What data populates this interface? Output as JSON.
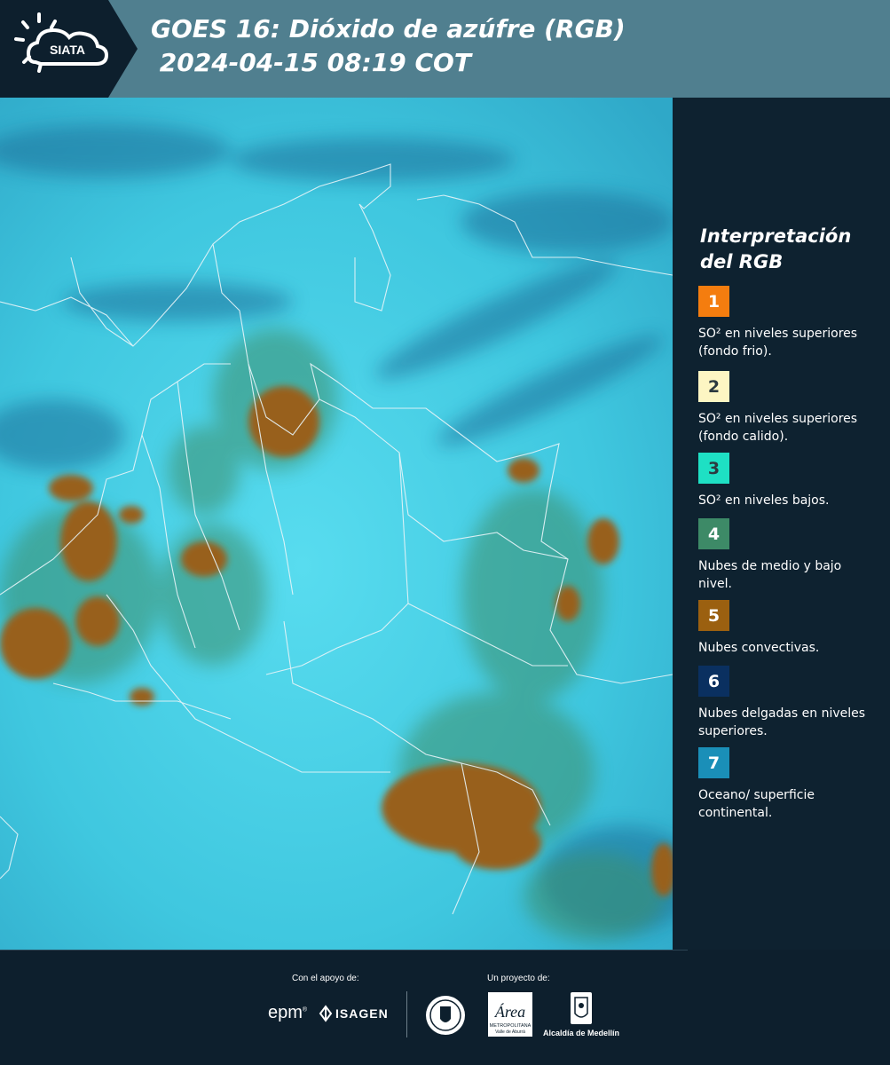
{
  "header": {
    "logo_text": "SIATA",
    "title": "GOES 16: Dióxido de azúfre (RGB)\n 2024-04-15 08:19 COT"
  },
  "legend": {
    "title": "Interpretación\ndel RGB",
    "items": [
      {
        "number": "1",
        "color": "#f47d0f",
        "text": "SO² en niveles superiores (fondo frio)."
      },
      {
        "number": "2",
        "color": "#fdf6c3",
        "text": "SO² en niveles superiores (fondo calido)."
      },
      {
        "number": "3",
        "color": "#1ee0c4",
        "text": "SO² en niveles bajos."
      },
      {
        "number": "4",
        "color": "#3d8a67",
        "text": "Nubes de medio y bajo nivel."
      },
      {
        "number": "5",
        "color": "#9b6010",
        "text": "Nubes convectivas."
      },
      {
        "number": "6",
        "color": "#0a3060",
        "text": "Nubes delgadas en niveles superiores."
      },
      {
        "number": "7",
        "color": "#1a8fb8",
        "text": "Oceano/ superficie continental."
      }
    ]
  },
  "footer": {
    "support_label": "Con el apoyo de:",
    "project_label": "Un proyecto de:",
    "epm_text": "epm",
    "isagen_text": "ISAGEN",
    "area_text": "Área",
    "area_sub": "METROPOLITANA",
    "area_sub2": "Valle de Aburrá",
    "alcaldia_text": "Alcaldía de Medellín"
  }
}
